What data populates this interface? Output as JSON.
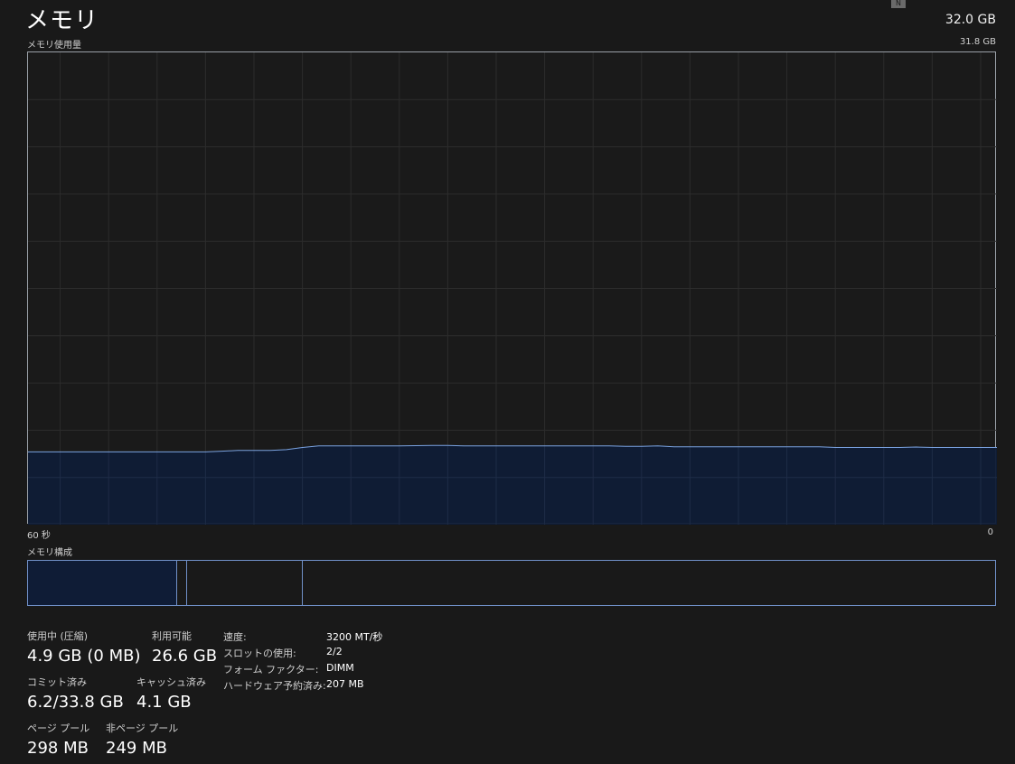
{
  "header": {
    "title": "メモリ",
    "total_capacity": "32.0 GB",
    "corner_badge": "N"
  },
  "graph": {
    "label": "メモリ使用量",
    "max_label": "31.8 GB",
    "x_left_label": "60 秒",
    "x_right_label": "0",
    "fill_color": "#0f1c36",
    "line_color": "#7aa2e0"
  },
  "chart_data": {
    "type": "area",
    "title": "メモリ使用量",
    "xlabel": "",
    "ylabel": "",
    "x_range": [
      60,
      0
    ],
    "ylim": [
      0,
      31.8
    ],
    "series": [
      {
        "values": [
          4.9,
          4.9,
          4.9,
          4.9,
          4.9,
          4.9,
          4.9,
          4.9,
          4.9,
          4.9,
          4.9,
          4.9,
          4.95,
          5.0,
          5.0,
          5.0,
          5.05,
          5.2,
          5.3,
          5.3,
          5.3,
          5.3,
          5.3,
          5.3,
          5.32,
          5.33,
          5.33,
          5.3,
          5.3,
          5.3,
          5.3,
          5.3,
          5.3,
          5.3,
          5.3,
          5.3,
          5.3,
          5.28,
          5.28,
          5.3,
          5.25,
          5.25,
          5.25,
          5.25,
          5.25,
          5.25,
          5.25,
          5.25,
          5.25,
          5.25,
          5.2,
          5.2,
          5.2,
          5.2,
          5.2,
          5.23,
          5.2,
          5.2,
          5.2,
          5.2,
          5.2
        ]
      }
    ]
  },
  "composition": {
    "label": "メモリ構成"
  },
  "stats": {
    "in_use_label": "使用中 (圧縮)",
    "in_use_value": "4.9 GB (0 MB)",
    "available_label": "利用可能",
    "available_value": "26.6 GB",
    "committed_label": "コミット済み",
    "committed_value": "6.2/33.8 GB",
    "cached_label": "キャッシュ済み",
    "cached_value": "4.1 GB",
    "paged_pool_label": "ページ プール",
    "paged_pool_value": "298 MB",
    "nonpaged_pool_label": "非ページ プール",
    "nonpaged_pool_value": "249 MB"
  },
  "specs": {
    "speed_label": "速度:",
    "speed_value": "3200 MT/秒",
    "slots_label": "スロットの使用:",
    "slots_value": "2/2",
    "form_label": "フォーム ファクター:",
    "form_value": "DIMM",
    "reserved_label": "ハードウェア予約済み:",
    "reserved_value": "207 MB"
  }
}
